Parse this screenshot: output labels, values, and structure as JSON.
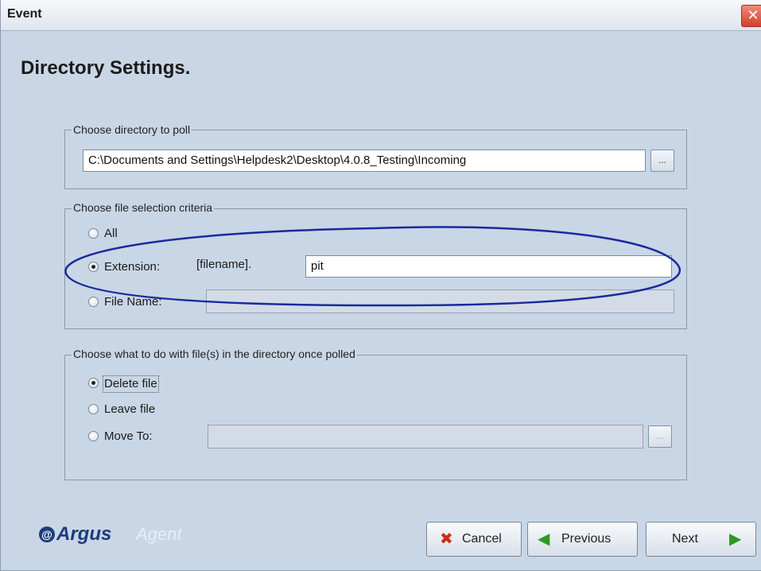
{
  "window": {
    "title": "Event",
    "close_glyph": "✕"
  },
  "heading": "Directory Settings.",
  "directory_group": {
    "title": "Choose directory to poll",
    "path_value": "C:\\Documents and Settings\\Helpdesk2\\Desktop\\4.0.8_Testing\\Incoming",
    "browse_label": "..."
  },
  "criteria_group": {
    "title": "Choose file selection criteria",
    "options": [
      {
        "label": "All",
        "selected": false
      },
      {
        "label": "Extension:",
        "selected": true
      },
      {
        "label": "File Name:",
        "selected": false
      }
    ],
    "filename_prefix": "[filename].",
    "extension_value": "pit",
    "filename_value": ""
  },
  "action_group": {
    "title": "Choose what to do with file(s) in the directory once polled",
    "options": [
      {
        "label": "Delete file",
        "selected": true
      },
      {
        "label": "Leave file",
        "selected": false
      },
      {
        "label": "Move To:",
        "selected": false
      }
    ],
    "move_to_value": "",
    "browse_label": "..."
  },
  "logo": {
    "mark": "@",
    "brand": "Argus",
    "product": "Agent"
  },
  "buttons": {
    "cancel": "Cancel",
    "previous": "Previous",
    "next": "Next"
  },
  "icons": {
    "cancel": "cross-icon",
    "previous": "arrow-left-icon",
    "next": "arrow-right-icon"
  },
  "colors": {
    "annotation_ellipse": "#1a2a9c",
    "cancel_icon": "#d22a1a",
    "arrow_icon": "#2e9a1e"
  }
}
